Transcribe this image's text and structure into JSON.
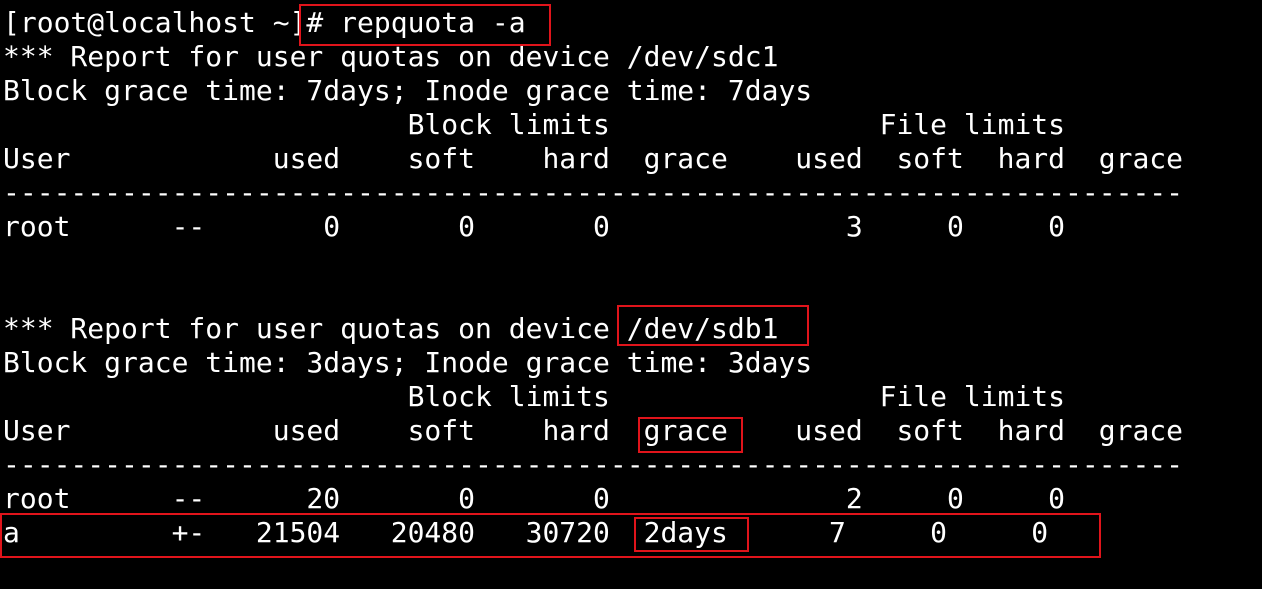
{
  "terminal": {
    "background": "#000000",
    "foreground": "#ffffff",
    "highlight_color": "#e0141b",
    "lines": [
      "[root@localhost ~]# repquota -a",
      "*** Report for user quotas on device /dev/sdc1",
      "Block grace time: 7days; Inode grace time: 7days",
      "                        Block limits                File limits",
      "User            used    soft    hard  grace    used  soft  hard  grace",
      "----------------------------------------------------------------------",
      "root      --       0       0       0              3     0     0",
      "",
      "",
      "*** Report for user quotas on device /dev/sdb1",
      "Block grace time: 3days; Inode grace time: 3days",
      "                        Block limits                File limits",
      "User            used    soft    hard  grace    used  soft  hard  grace",
      "----------------------------------------------------------------------",
      "root      --      20       0       0              2     0     0",
      "a         +-   21504   20480   30720  2days      7     0     0"
    ]
  }
}
